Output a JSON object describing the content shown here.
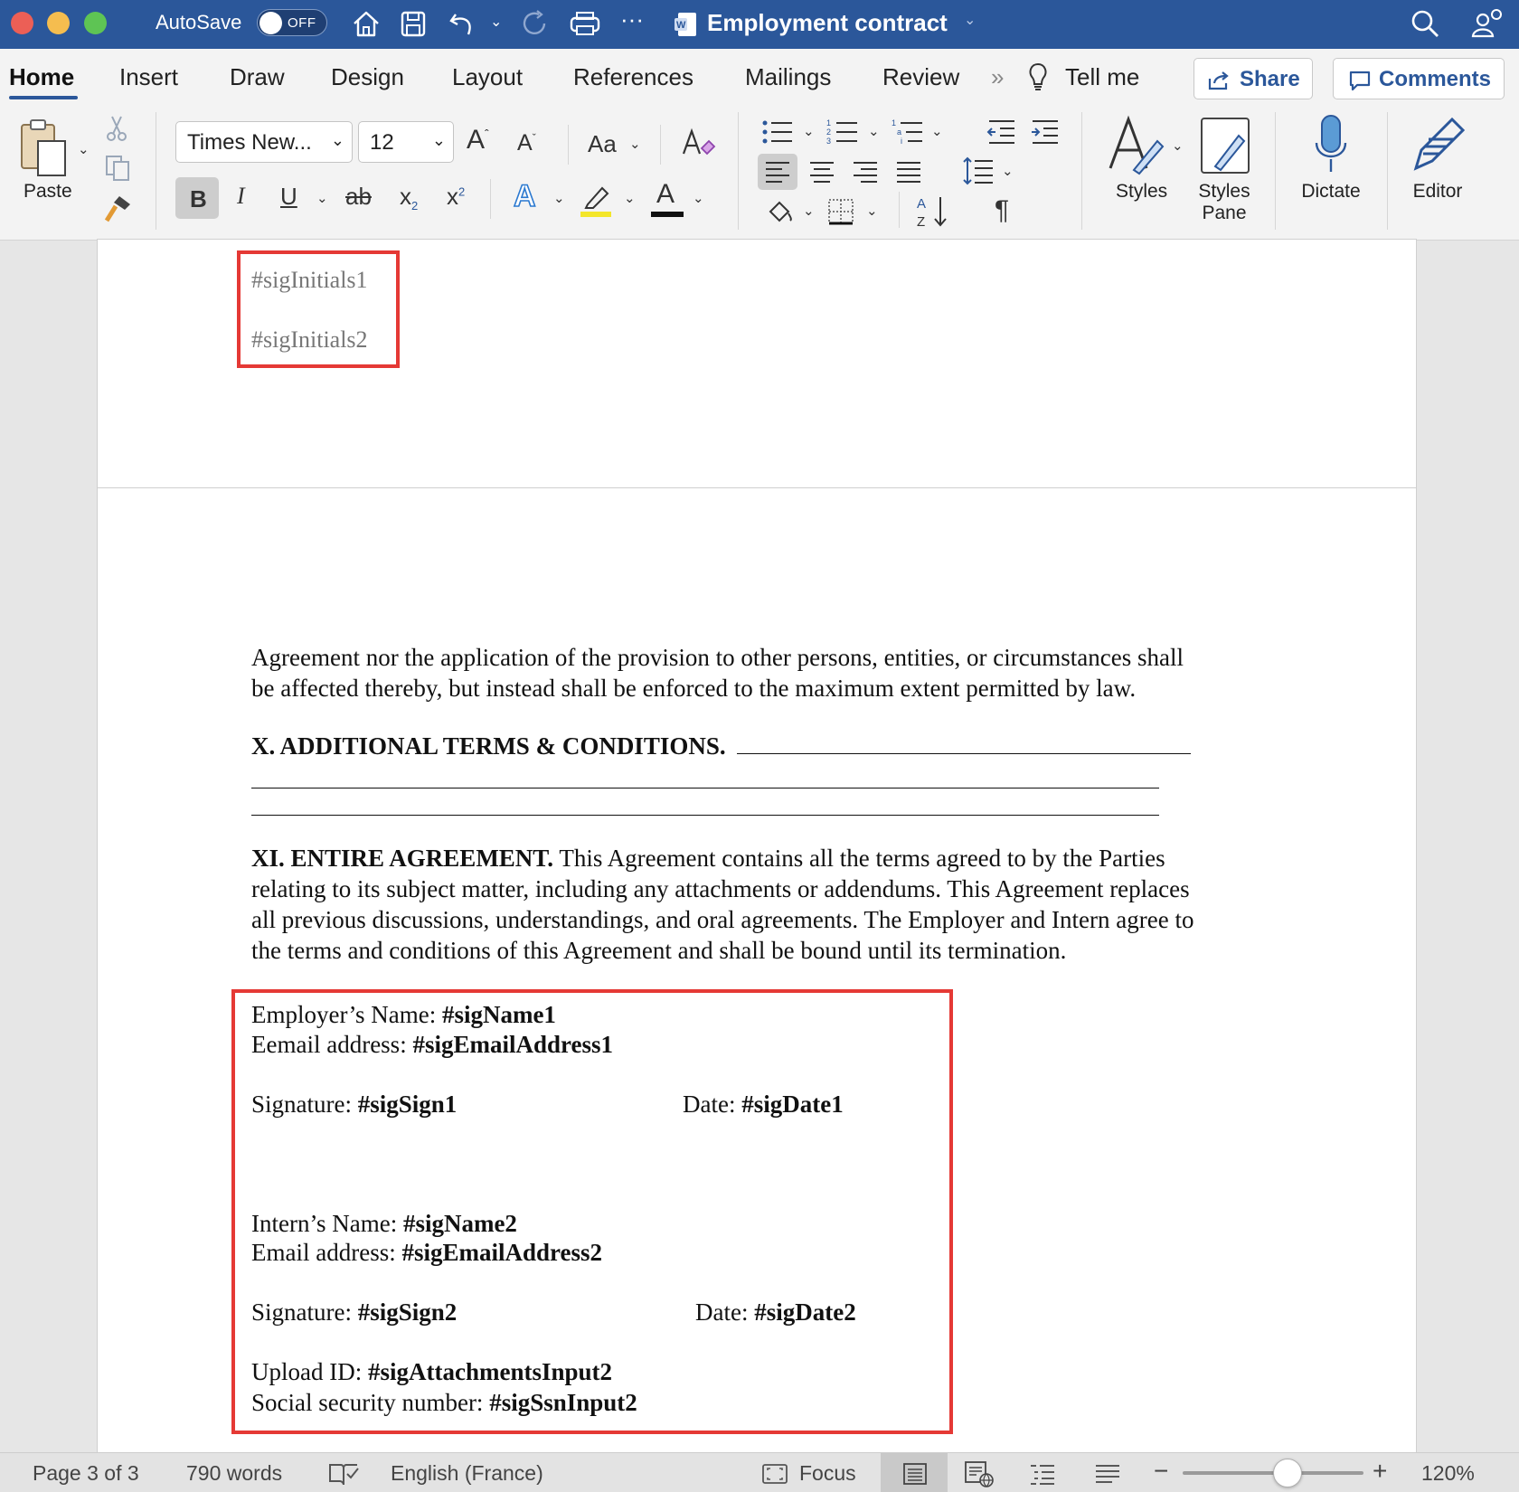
{
  "titlebar": {
    "autosave_label": "AutoSave",
    "autosave_state": "OFF",
    "doc_title": "Employment contract",
    "colors": {
      "bar": "#2b579a",
      "close": "#ec5f56",
      "minimize": "#f5bd4f",
      "maximize": "#5ec454"
    }
  },
  "tabs": [
    "Home",
    "Insert",
    "Draw",
    "Design",
    "Layout",
    "References",
    "Mailings",
    "Review"
  ],
  "tell_me": "Tell me",
  "share_label": "Share",
  "comments_label": "Comments",
  "ribbon": {
    "paste_label": "Paste",
    "font_name": "Times New...",
    "font_size": "12",
    "change_case": "Aa",
    "styles_label": "Styles",
    "styles_pane_line1": "Styles",
    "styles_pane_line2": "Pane",
    "dictate_label": "Dictate",
    "editor_label": "Editor"
  },
  "doc": {
    "initials1": "#sigInitials1",
    "initials2": "#sigInitials2",
    "para1_line1": "Agreement nor the application of the provision to other persons, entities, or circumstances shall",
    "para1_line2": "be affected thereby, but instead shall be enforced to the maximum extent permitted by law.",
    "sec10_heading": "X. ADDITIONAL TERMS & CONDITIONS.",
    "sec11_heading": "XI. ENTIRE AGREEMENT.",
    "sec11_line1": "This Agreement contains all the terms agreed to by the Parties",
    "sec11_line2": "relating to its subject matter, including any attachments or addendums. This Agreement replaces",
    "sec11_line3": "all previous discussions, understandings, and oral agreements. The Employer and Intern agree to",
    "sec11_line4": "the terms and conditions of this Agreement and shall be bound until its termination.",
    "employer_name_label": "Employer’s Name:",
    "employer_name_tag": "#sigName1",
    "employer_email_label": "Eemail address:",
    "employer_email_tag": "#sigEmailAddress1",
    "sig1_label": "Signature:",
    "sig1_tag": "#sigSign1",
    "date1_label": "Date:",
    "date1_tag": "#sigDate1",
    "intern_name_label": "Intern’s Name:",
    "intern_name_tag": "#sigName2",
    "intern_email_label": "Email address:",
    "intern_email_tag": "#sigEmailAddress2",
    "sig2_label": "Signature:",
    "sig2_tag": "#sigSign2",
    "date2_label": "Date:",
    "date2_tag": "#sigDate2",
    "upload_label": "Upload ID:",
    "upload_tag": "#sigAttachmentsInput2",
    "ssn_label": "Social security number:",
    "ssn_tag": "#sigSsnInput2",
    "highlight_color": "#e53935"
  },
  "statusbar": {
    "page": "Page 3 of 3",
    "words": "790 words",
    "language": "English (France)",
    "focus": "Focus",
    "zoom": "120%",
    "zoom_level_percent": 120
  }
}
